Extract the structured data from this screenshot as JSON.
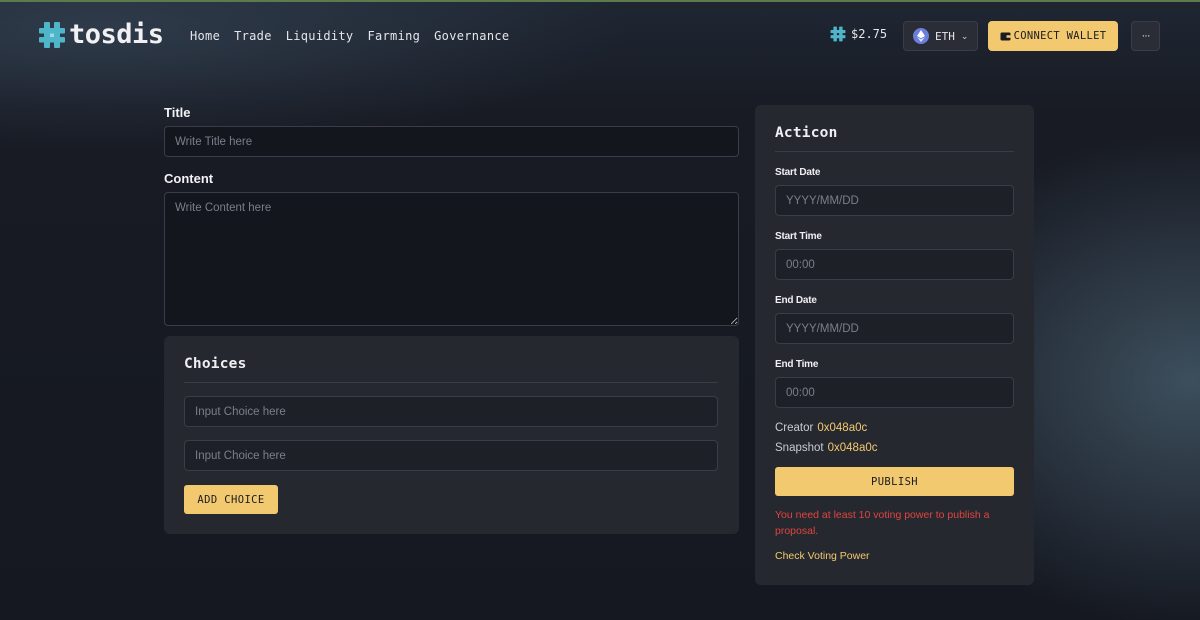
{
  "header": {
    "logo_text": "tosdis",
    "nav": [
      "Home",
      "Trade",
      "Liquidity",
      "Farming",
      "Governance"
    ],
    "price": "$2.75",
    "network": "ETH",
    "connect_label": "CONNECT WALLET",
    "more_label": "···"
  },
  "form": {
    "title_label": "Title",
    "title_placeholder": "Write Title here",
    "content_label": "Content",
    "content_placeholder": "Write Content here"
  },
  "choices": {
    "heading": "Choices",
    "placeholders": [
      "Input Choice here",
      "Input Choice here"
    ],
    "add_label": "ADD CHOICE"
  },
  "action": {
    "heading": "Acticon",
    "start_date_label": "Start Date",
    "start_date_placeholder": "YYYY/MM/DD",
    "start_time_label": "Start Time",
    "start_time_placeholder": "00:00",
    "end_date_label": "End Date",
    "end_date_placeholder": "YYYY/MM/DD",
    "end_time_label": "End Time",
    "end_time_placeholder": "00:00",
    "creator_label": "Creator",
    "creator_value": "0x048a0c",
    "snapshot_label": "Snapshot",
    "snapshot_value": "0x048a0c",
    "publish_label": "PUBLISH",
    "error_message": "You need at least 10 voting power to publish a proposal.",
    "check_link": "Check Voting Power"
  },
  "colors": {
    "accent": "#f3c96f",
    "logo_teal": "#4fb6c9",
    "error": "#e0453e",
    "card": "#262830"
  }
}
